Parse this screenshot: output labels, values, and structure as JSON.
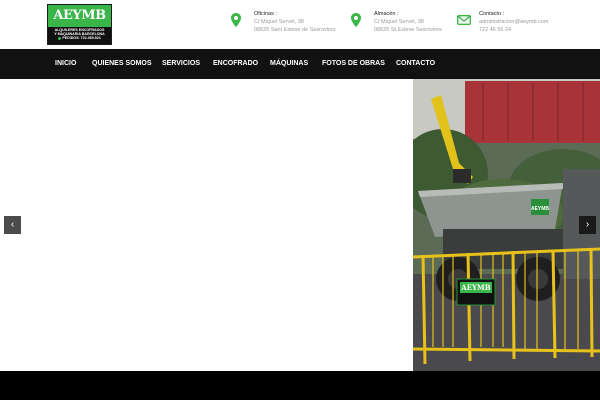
{
  "logo": {
    "brand": "AEYMB",
    "line1": "ALQUILERES ENCOFRADOS",
    "line2": "Y MAQUINARIA BARCELONA",
    "phone": "PEDIDOS: 722.465.524"
  },
  "contact": [
    {
      "label": "Oficinas :",
      "line1": "C/ Miquel Servet, 38",
      "line2": "08635 Sant Esteve de Sesrovires",
      "icon": "location-pin-icon"
    },
    {
      "label": "Almacén :",
      "line1": "C/ Miquel Servet, 38",
      "line2": "08635 St.Esteve Sesrovires",
      "icon": "location-pin-icon"
    },
    {
      "label": "Contacto :",
      "line1": "administracion@aeymb.com",
      "line2": "722 46 55 24",
      "icon": "envelope-icon"
    }
  ],
  "nav": {
    "items": [
      "INICIO",
      "QUIENES SOMOS",
      "SERVICIOS",
      "ENCOFRADO",
      "MÁQUINAS",
      "FOTOS DE OBRAS",
      "CONTACTO"
    ]
  },
  "slider": {
    "prev": "‹",
    "next": "›",
    "photo_sign": "AEYMB"
  },
  "colors": {
    "accent": "#39b54a",
    "nav_bg": "#111111"
  }
}
